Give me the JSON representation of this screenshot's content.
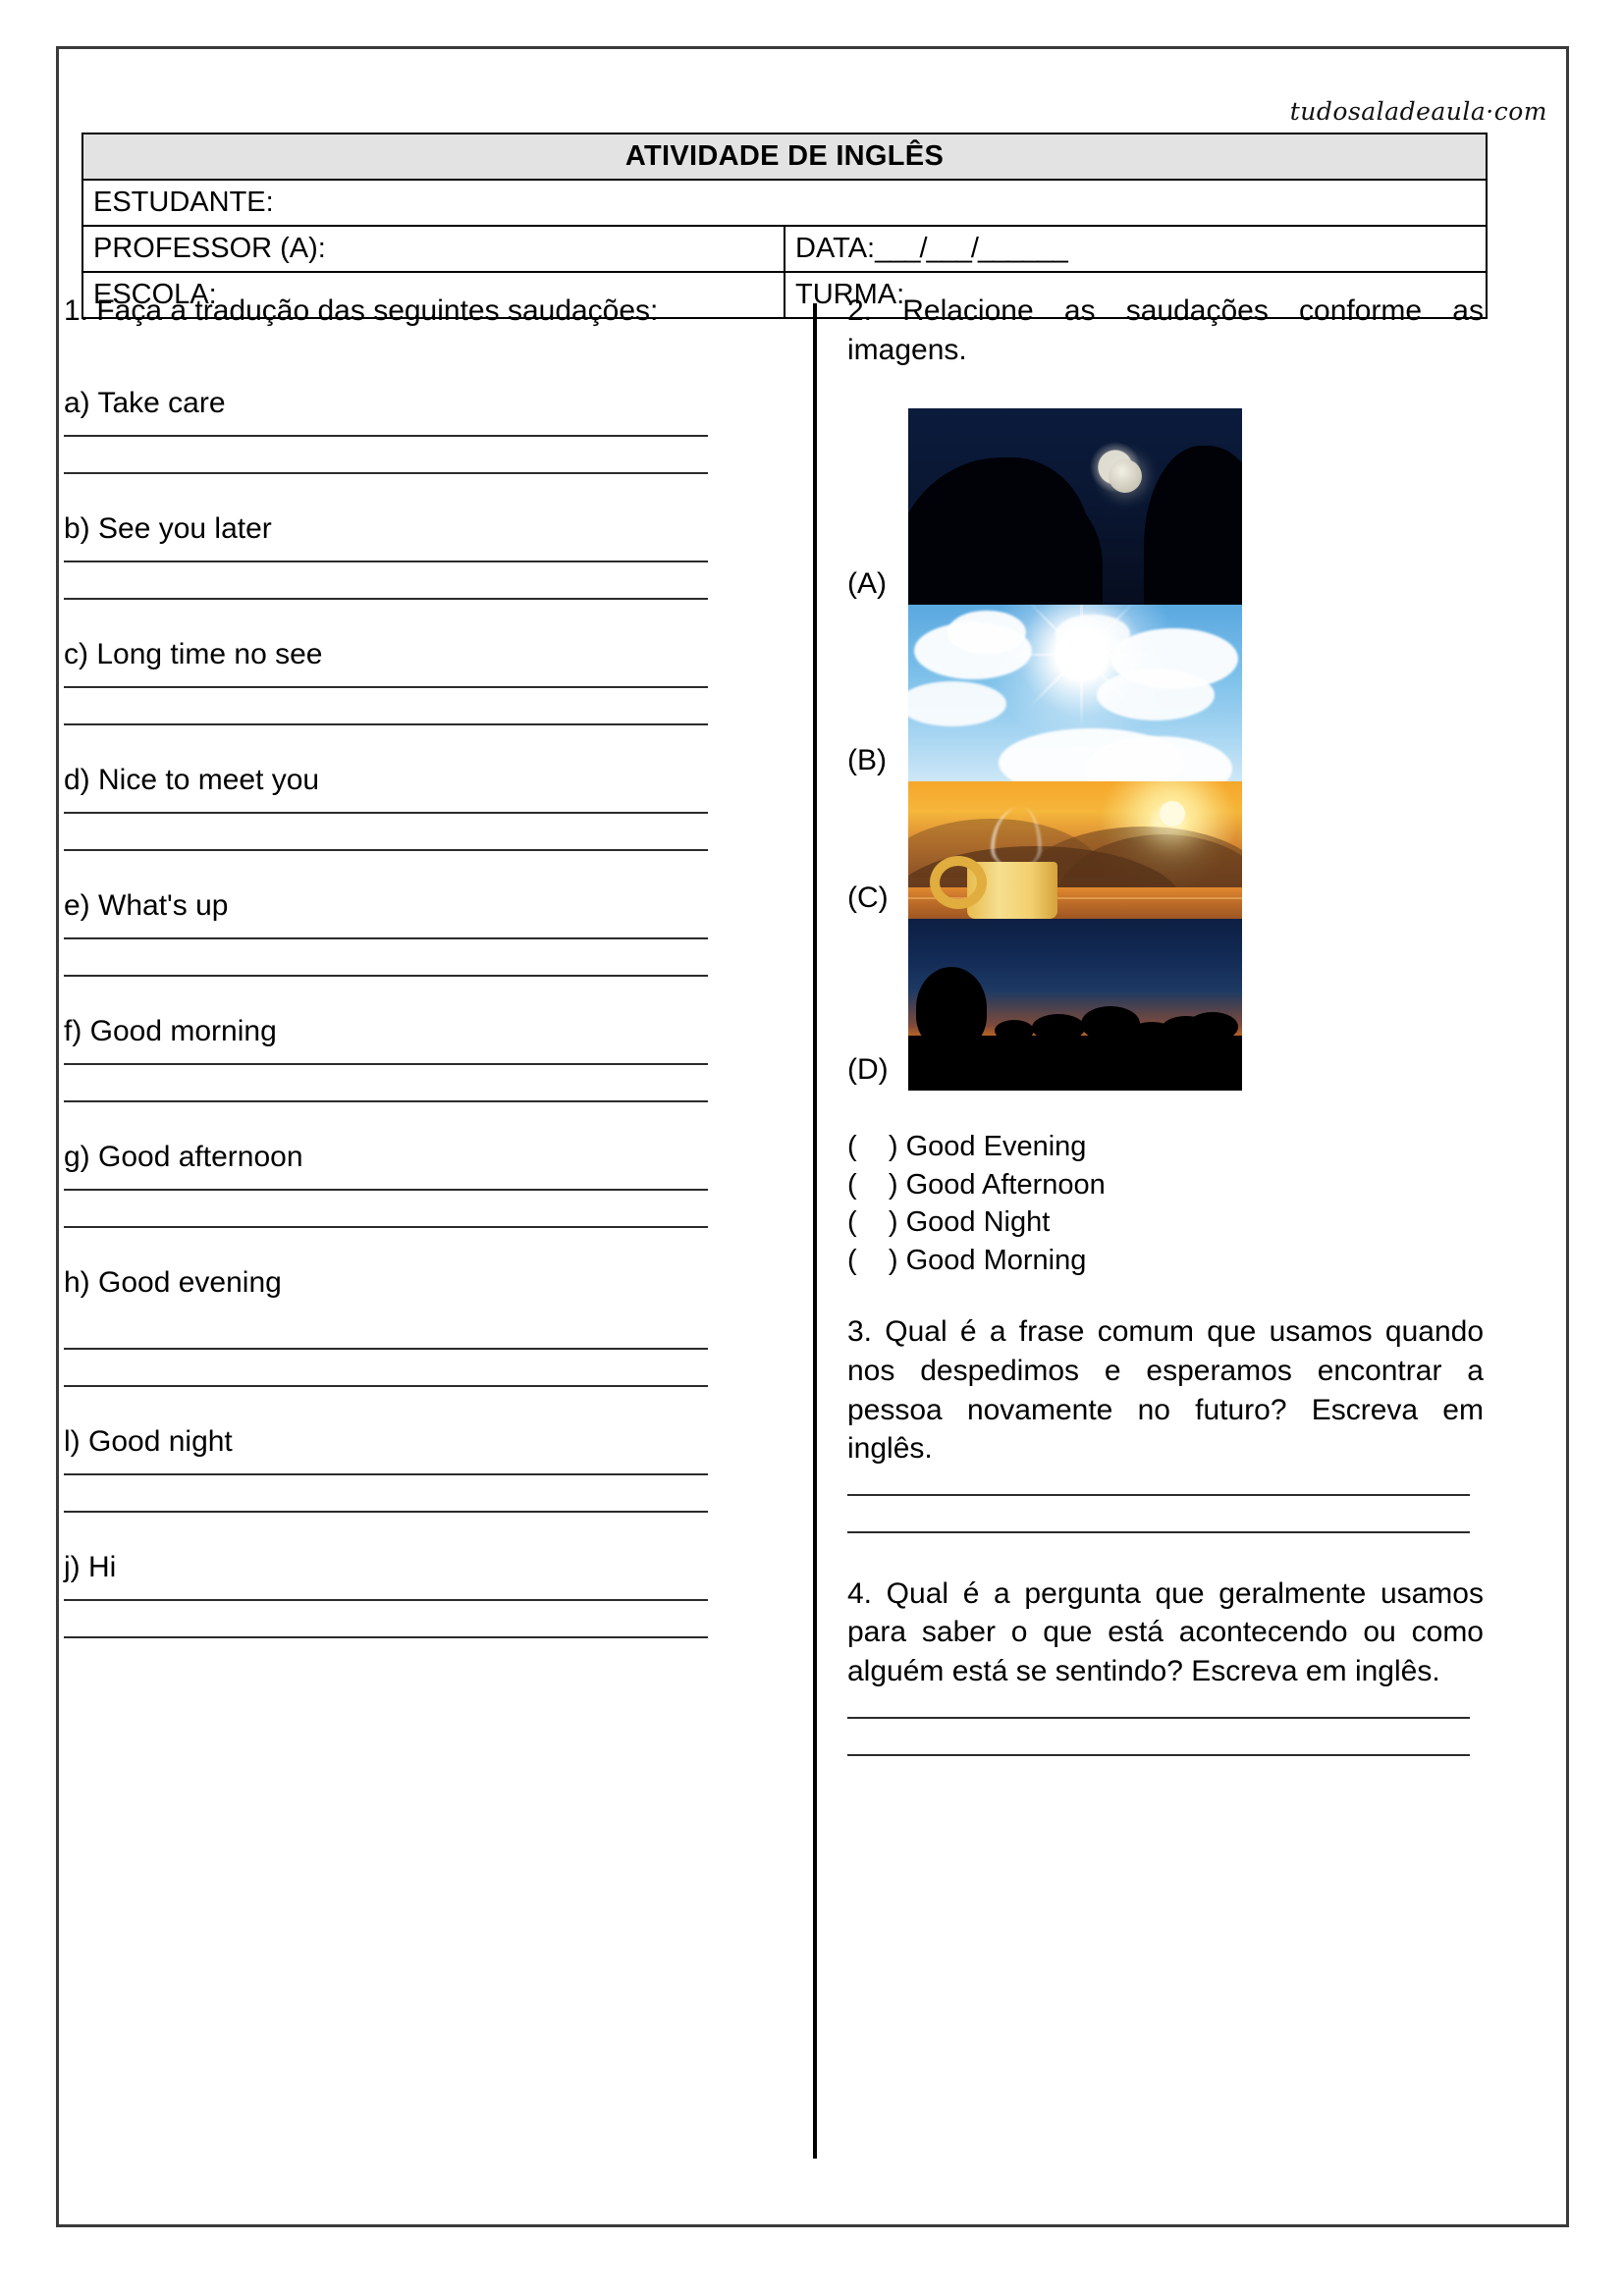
{
  "watermark": "tudosaladeaula·com",
  "header": {
    "title": "ATIVIDADE DE INGLÊS",
    "student_label": "ESTUDANTE:",
    "teacher_label": "PROFESSOR (A):",
    "school_label": "ESCOLA:",
    "date_label": "DATA:",
    "date_blanks": "___/___/______",
    "class_label": "TURMA:"
  },
  "left_column": {
    "question1": "1. Faça a tradução das seguintes saudações:",
    "items": [
      "a) Take care",
      "b) See you later",
      "c) Long time no see",
      "d) Nice to meet you",
      "e) What's up",
      "f) Good morning",
      "g) Good afternoon",
      "h) Good evening",
      "l) Good night",
      "j) Hi"
    ]
  },
  "right_column": {
    "question2": "2. Relacione as saudações conforme as imagens.",
    "images": [
      {
        "tag": "(A)",
        "name": "night-moon-photo"
      },
      {
        "tag": "(B)",
        "name": "sunny-sky-photo"
      },
      {
        "tag": "(C)",
        "name": "sunrise-coffee-photo"
      },
      {
        "tag": "(D)",
        "name": "dusk-sunset-photo"
      }
    ],
    "options": [
      "(    ) Good Evening",
      "(    ) Good Afternoon",
      "(    ) Good Night",
      "(    ) Good Morning"
    ],
    "question3": "3. Qual é a frase comum que usamos quando nos despedimos e esperamos encontrar a pessoa novamente no futuro? Escreva em inglês.",
    "question4": "4. Qual é a pergunta que geralmente usamos para saber o que está acontecendo ou como alguém está se sentindo? Escreva em inglês."
  },
  "colors": {
    "header_fill": "#e3e3e3",
    "border": "#000000",
    "page_border": "#3a3a3a",
    "rule": "#2b2b2b"
  }
}
